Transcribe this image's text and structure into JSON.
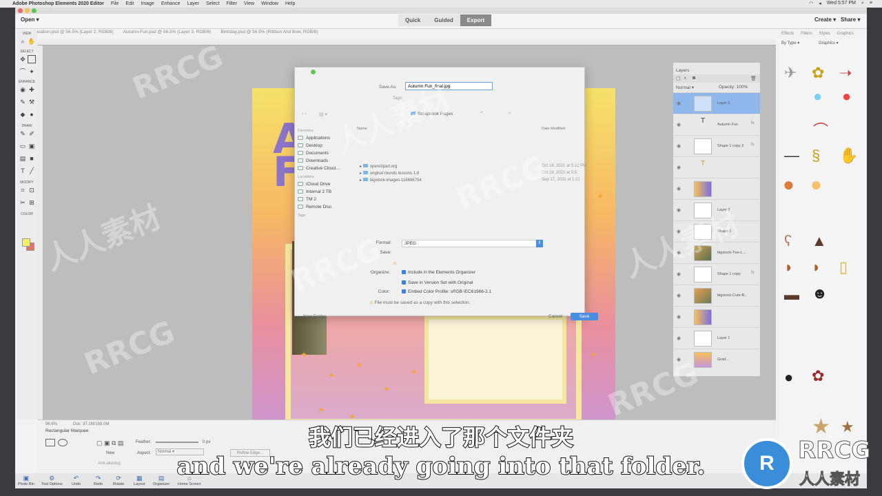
{
  "menubar": {
    "app_name": "Adobe Photoshop Elements 2020 Editor",
    "items": [
      "File",
      "Edit",
      "Image",
      "Enhance",
      "Layer",
      "Select",
      "Filter",
      "View",
      "Window",
      "Help"
    ],
    "clock": "Wed 5:57 PM"
  },
  "appbar": {
    "open_label": "Open",
    "modes": [
      "Quick",
      "Guided",
      "Export"
    ],
    "create_label": "Create",
    "share_label": "Share"
  },
  "doc_tabs": [
    "Vacation.psd @ 56.5% (Layer 2, RGB/8)",
    "Autumn-Fun.psd @ 56.5% (Layer 3, RGB/8)",
    "Birthday.psd @ 56.5% (Ribbon And Bow, RGB/8)"
  ],
  "panel_tabs": [
    "Effects",
    "Filters",
    "Styles",
    "Graphics"
  ],
  "toolbox": {
    "sections": [
      "VIEW",
      "SELECT",
      "ENHANCE",
      "DRAW",
      "MODIFY",
      "COLOR"
    ]
  },
  "artwork": {
    "title_line1": "Au",
    "title_line2": "Fu"
  },
  "dialog": {
    "save_as_label": "Save As:",
    "save_as_value": "Autumn Fun_final.jpg",
    "tags_label": "Tags:",
    "folder": "Scrapbook Pages",
    "favorites_heading": "Favorites",
    "favorites": [
      "Applications",
      "Desktop",
      "Documents",
      "Downloads",
      "Creative Cloud..."
    ],
    "locations_heading": "Locations",
    "locations": [
      "iCloud Drive",
      "Internal 2 TB",
      "TM 2",
      "Remote Disc"
    ],
    "tags_heading": "Tags",
    "col_name": "Name",
    "col_date": "Date Modified",
    "files": [
      {
        "name": "openclipart.org",
        "date": "Oct 18, 2021 at 5:12 PM"
      },
      {
        "name": "original rounds lessons 1-8",
        "date": "Oct 18, 2021 at 5:5"
      },
      {
        "name": "bigstock-images-116696754",
        "date": "Sep 17, 2021 at 1:21"
      }
    ],
    "format_label": "Format:",
    "format_value": "JPEG",
    "save_label": "Save:",
    "organize_label": "Organize:",
    "opt_organizer": "Include in the Elements Organizer",
    "opt_version": "Save in Version Set with Original",
    "color_label": "Color:",
    "opt_profile": "Embed Color Profile:  sRGB IEC61966-2.1",
    "warning": "File must be saved as a copy with this selection.",
    "new_folder": "New Folder",
    "cancel": "Cancel",
    "save": "Save"
  },
  "layers": {
    "title": "Layers",
    "blend_mode": "Normal",
    "opacity": "Opacity: 100%",
    "rows": [
      {
        "name": "Layer 3",
        "fx": ""
      },
      {
        "name": "Autumn Fun",
        "fx": "fx"
      },
      {
        "name": "Shape 1 copy 2",
        "fx": "fx"
      },
      {
        "name": "",
        "fx": ""
      },
      {
        "name": "",
        "fx": ""
      },
      {
        "name": "Layer 2",
        "fx": ""
      },
      {
        "name": "Shape 1",
        "fx": ""
      },
      {
        "name": "bigstock-Two-L...",
        "fx": ""
      },
      {
        "name": "Shape 1 copy",
        "fx": "fx"
      },
      {
        "name": "bigstock-Cute-B...",
        "fx": ""
      },
      {
        "name": "",
        "fx": ""
      },
      {
        "name": "Layer 1",
        "fx": ""
      },
      {
        "name": "Grad...",
        "fx": ""
      }
    ]
  },
  "graphics": {
    "by_type": "By Type",
    "category": "Graphics"
  },
  "tool_options": {
    "zoom": "56.6%",
    "doc_info": "Doc: 37.1M/169.0M",
    "tool_name": "Rectangular Marquee",
    "new_label": "New",
    "feather_label": "Feather:",
    "feather_value": "0 px",
    "aspect_label": "Aspect:",
    "aspect_value": "Normal",
    "antialias_label": "Anti-aliasing",
    "refine_edge": "Refine Edge..."
  },
  "taskbar": [
    "Photo Bin",
    "Tool Options",
    "Undo",
    "Redo",
    "Rotate",
    "Layout",
    "Organizer",
    "Home Screen"
  ],
  "subtitles": {
    "cn": "我们已经进入了那个文件夹",
    "en": "and we're already going into that folder."
  },
  "watermark": {
    "brand": "RRCG",
    "brand_cn": "人人素材"
  },
  "colors": {
    "accent": "#4a8ee0",
    "foreground": "#f5f06a",
    "background": "#e4726a"
  }
}
